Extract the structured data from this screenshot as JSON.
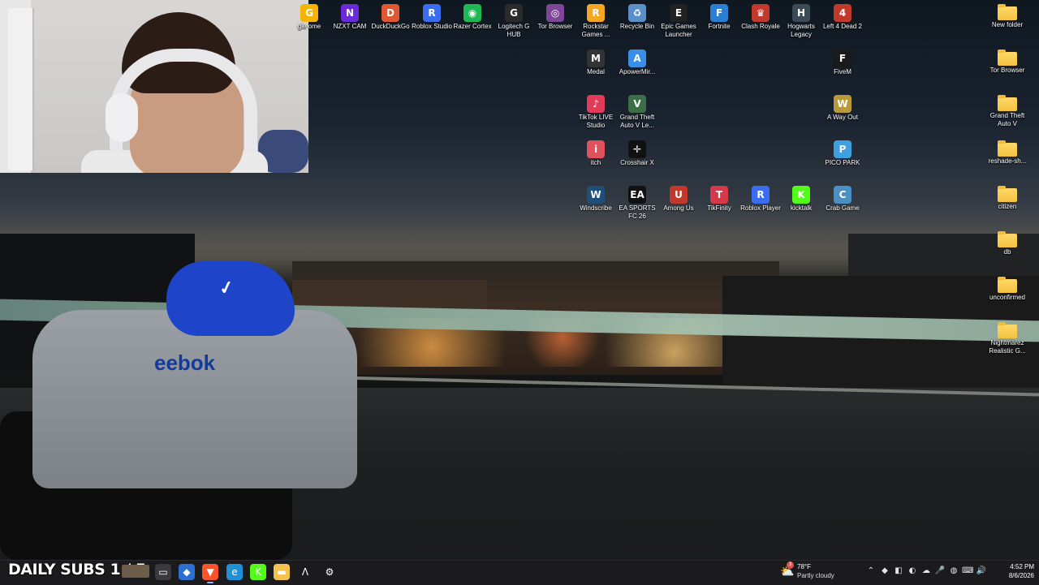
{
  "desktop": {
    "icons": [
      {
        "label": "gle ome",
        "glyph": "G",
        "color": "#f4b400",
        "name": "google-chrome-icon"
      },
      {
        "label": "NZXT CAM",
        "glyph": "N",
        "color": "#6c2bd9",
        "name": "nzxt-cam-icon"
      },
      {
        "label": "DuckDuckGo",
        "glyph": "D",
        "color": "#de5833",
        "name": "duckduckgo-icon"
      },
      {
        "label": "Roblox Studio",
        "glyph": "R",
        "color": "#3a6df0",
        "name": "roblox-studio-icon"
      },
      {
        "label": "Razer Cortex",
        "glyph": "◉",
        "color": "#1db954",
        "name": "razer-cortex-icon"
      },
      {
        "label": "Logitech G HUB",
        "glyph": "G",
        "color": "#2b2b2b",
        "name": "logitech-ghub-icon"
      },
      {
        "label": "Tor Browser",
        "glyph": "◎",
        "color": "#7d4698",
        "name": "tor-browser-icon"
      },
      {
        "label": "Rockstar Games ...",
        "glyph": "R",
        "color": "#f5a623",
        "name": "rockstar-games-icon"
      },
      {
        "label": "Recycle Bin",
        "glyph": "♻",
        "color": "#5a8fc9",
        "name": "recycle-bin-icon"
      },
      {
        "label": "Epic Games Launcher",
        "glyph": "E",
        "color": "#222",
        "name": "epic-games-icon"
      },
      {
        "label": "Fortnite",
        "glyph": "F",
        "color": "#2a7fd4",
        "name": "fortnite-icon"
      },
      {
        "label": "Clash Royale",
        "glyph": "♛",
        "color": "#c0392b",
        "name": "clash-royale-icon"
      },
      {
        "label": "Hogwarts Legacy",
        "glyph": "H",
        "color": "#3b4a55",
        "name": "hogwarts-legacy-icon"
      },
      {
        "label": "Left 4 Dead 2",
        "glyph": "4",
        "color": "#c0392b",
        "name": "left4dead2-icon"
      },
      {
        "label": "Medal",
        "glyph": "M",
        "color": "#333",
        "name": "medal-icon"
      },
      {
        "label": "ApowerMir...",
        "glyph": "A",
        "color": "#3a8ee6",
        "name": "apowermirror-icon"
      },
      {
        "label": "FiveM",
        "glyph": "F",
        "color": "#1a1a1a",
        "name": "fivem-icon"
      },
      {
        "label": "TikTok LIVE Studio",
        "glyph": "♪",
        "color": "#e23b5a",
        "name": "tiktok-live-icon"
      },
      {
        "label": "Grand Theft Auto V Le...",
        "glyph": "V",
        "color": "#3c6e47",
        "name": "gta-v-legacy-icon"
      },
      {
        "label": "A Way Out",
        "glyph": "W",
        "color": "#b89a3a",
        "name": "a-way-out-icon"
      },
      {
        "label": "itch",
        "glyph": "i",
        "color": "#e0525b",
        "name": "itch-icon"
      },
      {
        "label": "Crosshair X",
        "glyph": "✛",
        "color": "#111",
        "name": "crosshair-x-icon"
      },
      {
        "label": "PICO PARK",
        "glyph": "P",
        "color": "#3fa0e0",
        "name": "pico-park-icon"
      },
      {
        "label": "Windscribe",
        "glyph": "W",
        "color": "#1f4e79",
        "name": "windscribe-icon"
      },
      {
        "label": "EA SPORTS FC 26",
        "glyph": "EA",
        "color": "#111",
        "name": "ea-fc-icon"
      },
      {
        "label": "Among Us",
        "glyph": "U",
        "color": "#c0392b",
        "name": "among-us-icon"
      },
      {
        "label": "TikFinity",
        "glyph": "T",
        "color": "#d63a4a",
        "name": "tikfinity-icon"
      },
      {
        "label": "Roblox Player",
        "glyph": "R",
        "color": "#3a6df0",
        "name": "roblox-player-icon"
      },
      {
        "label": "kicktalk",
        "glyph": "K",
        "color": "#53fc18",
        "name": "kicktalk-icon"
      },
      {
        "label": "Crab Game",
        "glyph": "C",
        "color": "#4a90c2",
        "name": "crab-game-icon"
      }
    ],
    "folders": [
      {
        "label": "New folder"
      },
      {
        "label": "Tor Browser"
      },
      {
        "label": "Grand Theft Auto V"
      },
      {
        "label": "reshade-sh..."
      },
      {
        "label": "citizen"
      },
      {
        "label": "db"
      },
      {
        "label": "unconfirmed"
      },
      {
        "label": "Nightmarez Realistic G..."
      }
    ]
  },
  "wallpaper": {
    "shirt_text": "eebok"
  },
  "overlay": {
    "daily_subs": "DAILY SUBS 1 / 5"
  },
  "taskbar": {
    "apps": [
      {
        "glyph": "▭",
        "color": "#3a3a3d",
        "name": "task-view-icon"
      },
      {
        "glyph": "◆",
        "color": "#2b6fd1",
        "name": "copilot-icon"
      },
      {
        "glyph": "▼",
        "color": "#fb542b",
        "name": "brave-browser-icon"
      },
      {
        "glyph": "e",
        "color": "#1f8fd6",
        "name": "edge-browser-icon"
      },
      {
        "glyph": "K",
        "color": "#53fc18",
        "name": "kick-icon"
      },
      {
        "glyph": "▬",
        "color": "#f2c24c",
        "name": "file-explorer-icon"
      },
      {
        "glyph": "Λ",
        "color": "#1b1b1d",
        "name": "fivem-taskbar-icon"
      },
      {
        "glyph": "⚙",
        "color": "#1b1b1d",
        "name": "settings-icon"
      }
    ],
    "weather": {
      "temp": "78°F",
      "condition": "Partly cloudy",
      "badge": "3"
    },
    "tray": [
      {
        "glyph": "⌃",
        "name": "show-hidden-icons"
      },
      {
        "glyph": "◆",
        "name": "tray-app-icon-1"
      },
      {
        "glyph": "◧",
        "name": "tray-app-icon-2"
      },
      {
        "glyph": "◐",
        "name": "tray-app-icon-3"
      },
      {
        "glyph": "☁",
        "name": "onedrive-icon"
      },
      {
        "glyph": "🎤",
        "name": "microphone-icon"
      },
      {
        "glyph": "◍",
        "name": "network-icon"
      },
      {
        "glyph": "⌨",
        "name": "keyboard-icon"
      },
      {
        "glyph": "🔊",
        "name": "volume-icon"
      }
    ],
    "clock": {
      "time": "4:52 PM",
      "date": "8/6/2026"
    }
  }
}
